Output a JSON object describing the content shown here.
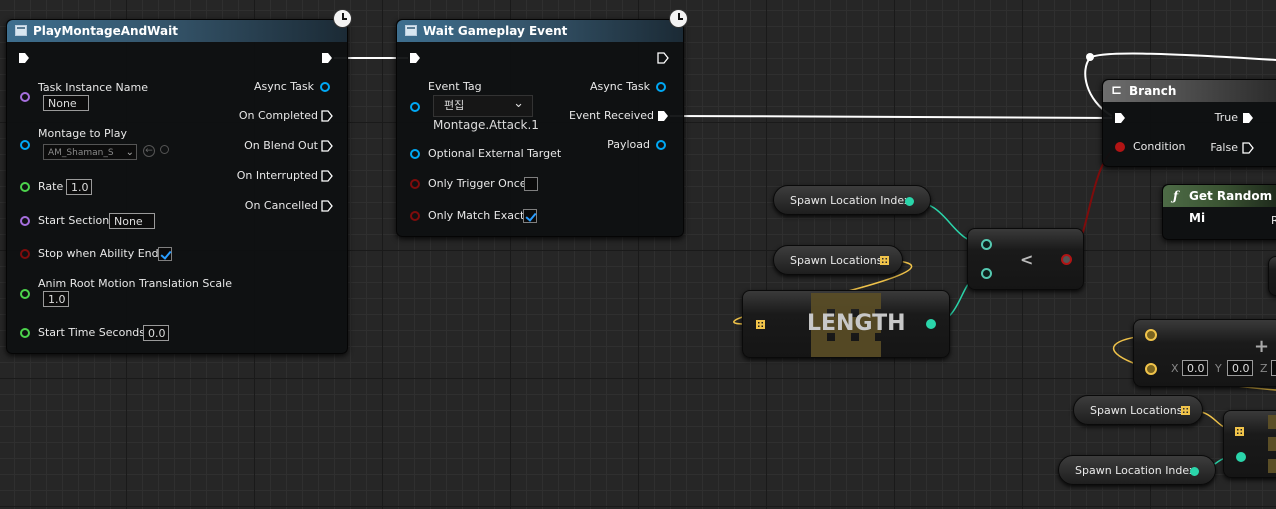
{
  "colors": {
    "exec": "#ffffff",
    "object_pin": "#00a8f4",
    "bool_pin": "#b21414",
    "float_pin": "#4cd34c",
    "name_pin": "#a66fde",
    "int_pin": "#2ad5aa",
    "vector_pin": "#f0c34a",
    "function_header": "#4d6b46",
    "task_header": "#3e6f8f"
  },
  "play_montage": {
    "title": "PlayMontageAndWait",
    "icon": "clock-icon",
    "inputs": {
      "task_instance_name": "Task Instance Name",
      "task_instance_value": "None",
      "montage_to_play": "Montage to Play",
      "montage_value": "AM_Shaman_S",
      "rate": "Rate",
      "rate_value": "1.0",
      "start_section": "Start Section",
      "start_section_value": "None",
      "stop_when_ability_ends": "Stop when Ability Ends",
      "anim_root_motion": "Anim Root Motion Translation Scale",
      "anim_root_motion_value": "1.0",
      "start_time_seconds": "Start Time Seconds",
      "start_time_value": "0.0"
    },
    "outputs": {
      "async_task": "Async Task",
      "on_completed": "On Completed",
      "on_blend_out": "On Blend Out",
      "on_interrupted": "On Interrupted",
      "on_cancelled": "On Cancelled"
    }
  },
  "wait_event": {
    "title": "Wait Gameplay Event",
    "icon": "clock-icon",
    "inputs": {
      "event_tag": "Event Tag",
      "event_tag_value": "편집",
      "event_tag_name": "Montage.Attack.1",
      "optional_external_target": "Optional External Target",
      "only_trigger_once": "Only Trigger Once",
      "only_match_exact": "Only Match Exact"
    },
    "outputs": {
      "async_task": "Async Task",
      "event_received": "Event Received",
      "payload": "Payload"
    }
  },
  "branch": {
    "title": "Branch",
    "condition": "Condition",
    "true_label": "True",
    "false_label": "False"
  },
  "get_random": {
    "title": "Get Random Mi",
    "partial": "R"
  },
  "vars": {
    "spawn_location_index": "Spawn Location Index",
    "spawn_locations": "Spawn Locations",
    "spawn_locations_2": "Spawn Locations",
    "spawn_location_index_2": "Spawn Location Index"
  },
  "length_node": {
    "label": "LENGTH"
  },
  "less_node": {
    "label": "<"
  },
  "add_node": {
    "x_label": "X",
    "x_value": "0.0",
    "y_label": "Y",
    "y_value": "0.0",
    "z_label": "Z",
    "plus": "+"
  }
}
